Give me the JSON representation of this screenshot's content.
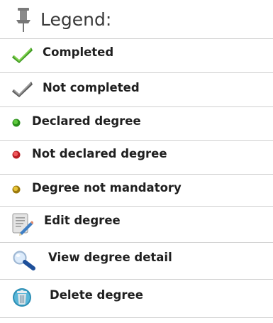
{
  "legend": {
    "title": "Legend:",
    "title_icon": "pin-icon",
    "items": [
      {
        "label": "Completed",
        "icon": "check-green-icon",
        "icon_color": "#5cb82e"
      },
      {
        "label": "Not completed",
        "icon": "check-grey-icon",
        "icon_color": "#777777"
      },
      {
        "label": "Declared degree",
        "icon": "dot-green-icon",
        "icon_color": "#3fae2a"
      },
      {
        "label": "Not declared degree",
        "icon": "dot-red-icon",
        "icon_color": "#e0393e"
      },
      {
        "label": "Degree not mandatory",
        "icon": "dot-yellow-icon",
        "icon_color": "#d9b21f"
      },
      {
        "label": "Edit degree",
        "icon": "edit-pencil-icon",
        "icon_color": "#3f7fc4"
      },
      {
        "label": "View degree detail",
        "icon": "magnifier-icon",
        "icon_color": "#4a7fb8"
      },
      {
        "label": "Delete degree",
        "icon": "trash-icon",
        "icon_color": "#2d8fb5"
      }
    ]
  }
}
